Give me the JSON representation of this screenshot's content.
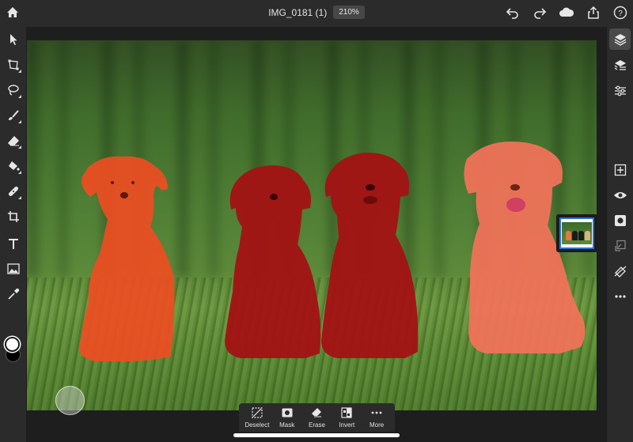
{
  "header": {
    "document_title": "IMG_0181 (1)",
    "zoom": "210%",
    "icons": [
      "home-icon",
      "undo-icon",
      "redo-icon",
      "cloud-icon",
      "share-icon",
      "help-icon"
    ]
  },
  "left_toolbar": {
    "tools": [
      "select-icon",
      "transform-icon",
      "lasso-icon",
      "brush-icon",
      "eraser-icon",
      "fill-icon",
      "healing-icon",
      "crop-icon",
      "type-icon",
      "image-icon",
      "eyedropper-icon"
    ],
    "foreground_color": "#ffffff",
    "background_color": "#000000"
  },
  "right_panel": {
    "tools": [
      "layers-icon",
      "layer-properties-icon",
      "adjustments-icon",
      "add-layer-icon",
      "visibility-icon",
      "mask-icon",
      "merge-icon",
      "clear-icon",
      "more-icon"
    ]
  },
  "canvas": {
    "selection_overlay_color": "#ff2a1f"
  },
  "taskbar": {
    "actions": [
      {
        "label": "Deselect",
        "icon": "deselect-icon"
      },
      {
        "label": "Mask",
        "icon": "mask-icon"
      },
      {
        "label": "Erase",
        "icon": "erase-icon"
      },
      {
        "label": "Invert",
        "icon": "invert-icon"
      },
      {
        "label": "More",
        "icon": "more-icon"
      }
    ]
  }
}
